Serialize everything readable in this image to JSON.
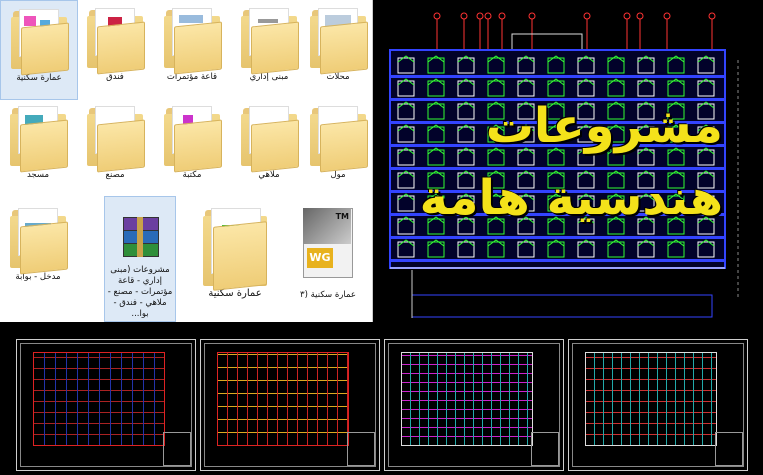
{
  "explorer": {
    "items": [
      {
        "label": "عمارة سكنية",
        "selected": true
      },
      {
        "label": "فندق"
      },
      {
        "label": "قاعة مؤتمرات"
      },
      {
        "label": "مبنى إداري"
      },
      {
        "label": "محلات"
      },
      {
        "label": "مسجد"
      },
      {
        "label": "مصنع"
      },
      {
        "label": "مكتبة"
      },
      {
        "label": "ملاهي"
      },
      {
        "label": "مول"
      },
      {
        "label": "مدخل - بوابة"
      },
      {
        "label": "مشروعات (مبنى إداري - قاعة مؤتمرات - مصنع - ملاهي - فندق - بوا..."
      },
      {
        "label": "عمارة سكنية"
      },
      {
        "label": "عمارة سكنية (٣"
      }
    ]
  },
  "overlay": {
    "line1": "مشروعات",
    "line2": "هندسية هامة"
  },
  "file_icons": {
    "archive_icon": "winrar-archive-icon",
    "doc_icon_text": "TM",
    "doc_icon_badge": "WG"
  },
  "colors": {
    "overlay_text": "#f4e21a",
    "cad_bg": "#000000",
    "folder": "#efcd77"
  }
}
